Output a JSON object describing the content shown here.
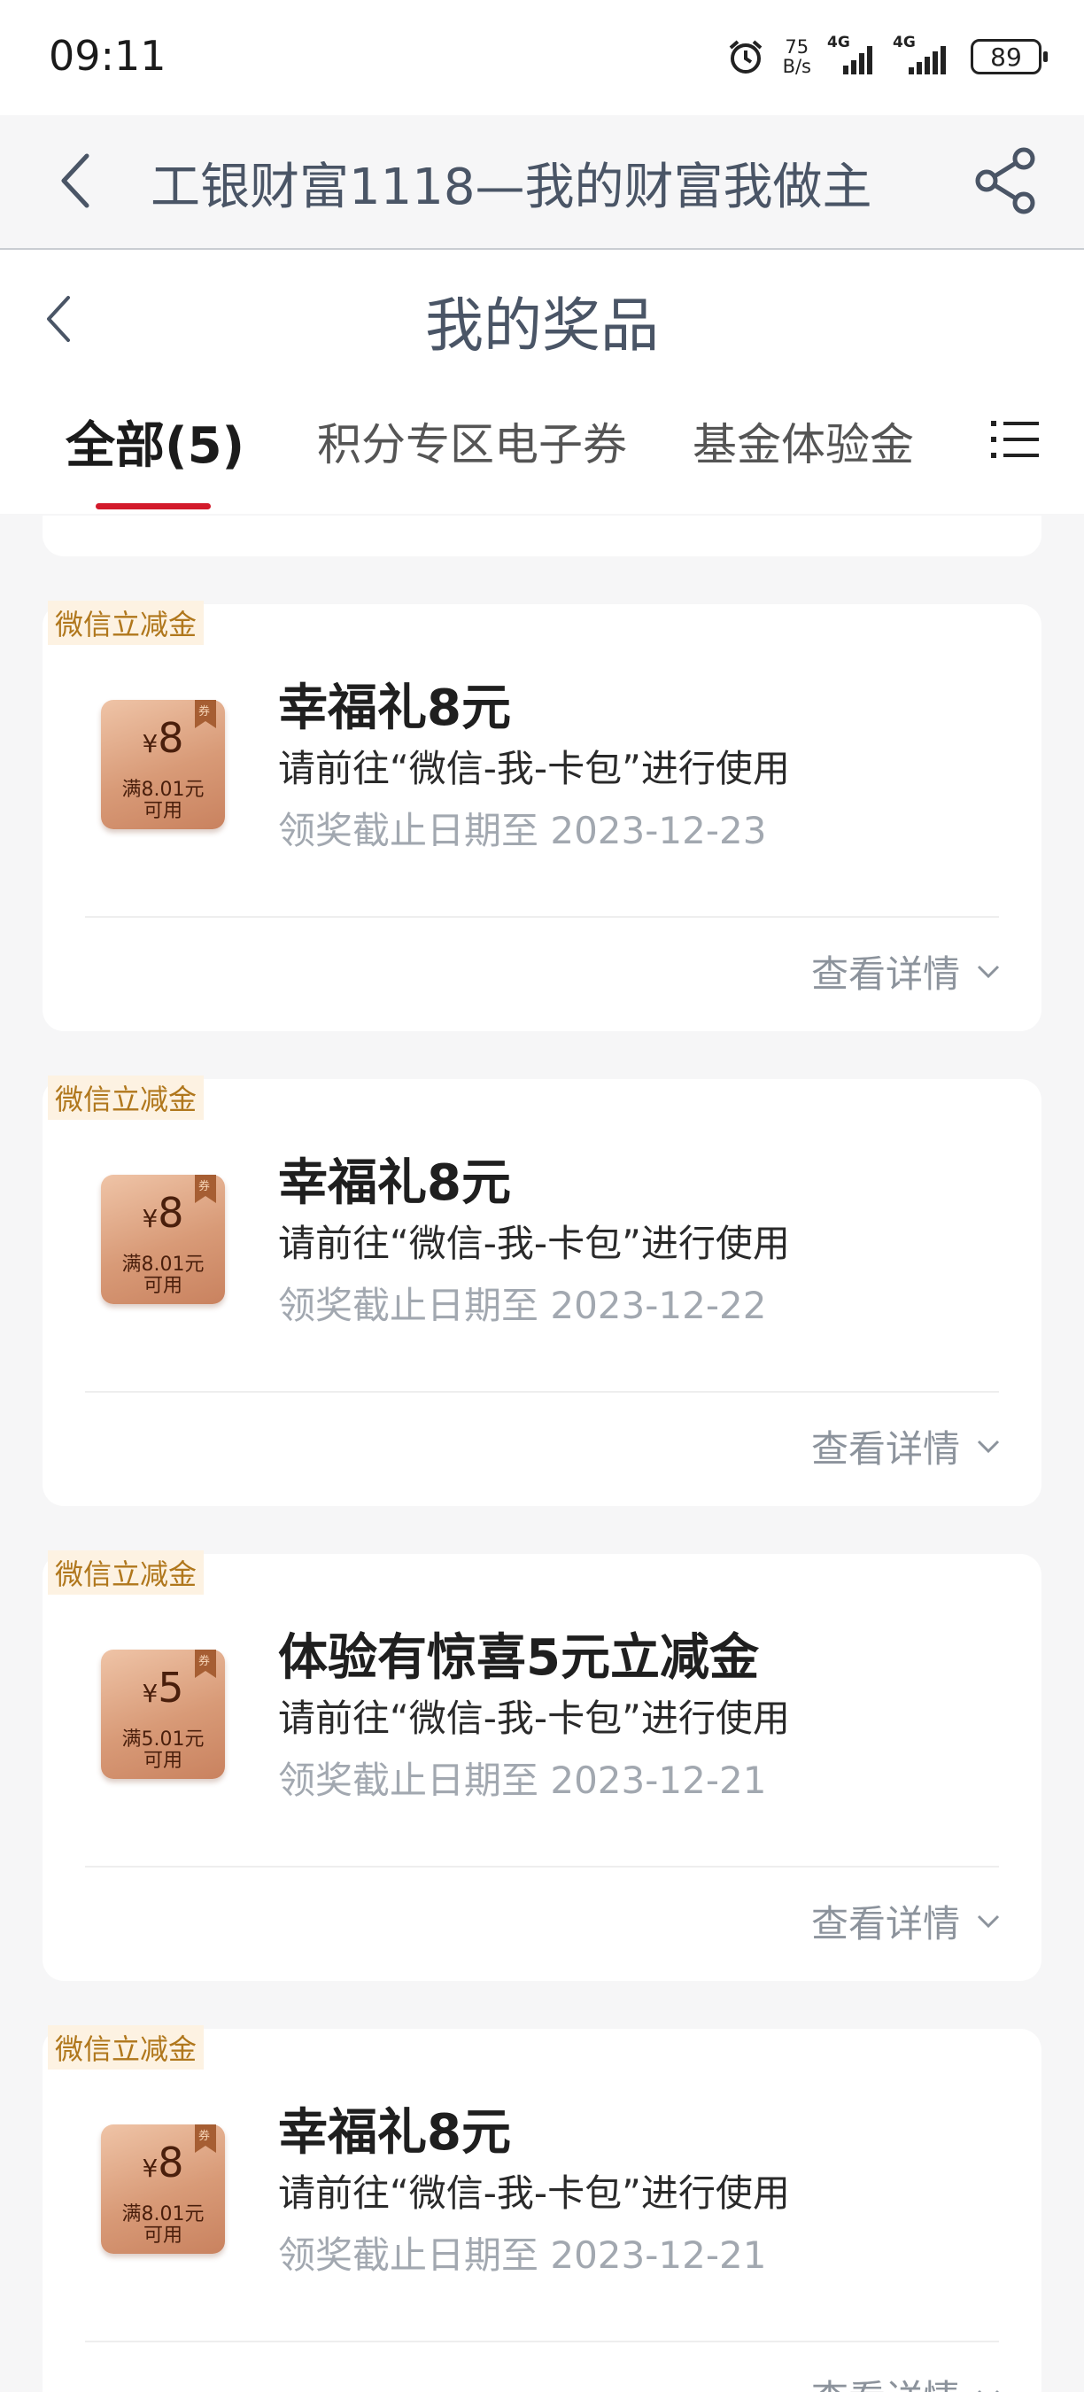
{
  "status_bar": {
    "time": "09:11",
    "net_speed_value": "75",
    "net_speed_unit": "B/s",
    "signal1": "4G",
    "signal2": "4G",
    "battery": "89"
  },
  "app_bar": {
    "title": "工银财富1118—我的财富我做主"
  },
  "page": {
    "title": "我的奖品"
  },
  "tabs": [
    {
      "label": "全部(5)",
      "active": true
    },
    {
      "label": "积分专区电子券",
      "active": false
    },
    {
      "label": "基金体验金",
      "active": false
    }
  ],
  "prizes": [
    {
      "tag": "微信立减金",
      "coupon_symbol": "¥",
      "coupon_amount": "8",
      "coupon_condition": "满8.01元",
      "coupon_usable": "可用",
      "coupon_flag": "券",
      "title": "幸福礼8元",
      "description": "请前往“微信-我-卡包”进行使用",
      "deadline": "领奖截止日期至 2023-12-23",
      "detail_label": "查看详情"
    },
    {
      "tag": "微信立减金",
      "coupon_symbol": "¥",
      "coupon_amount": "8",
      "coupon_condition": "满8.01元",
      "coupon_usable": "可用",
      "coupon_flag": "券",
      "title": "幸福礼8元",
      "description": "请前往“微信-我-卡包”进行使用",
      "deadline": "领奖截止日期至 2023-12-22",
      "detail_label": "查看详情"
    },
    {
      "tag": "微信立减金",
      "coupon_symbol": "¥",
      "coupon_amount": "5",
      "coupon_condition": "满5.01元",
      "coupon_usable": "可用",
      "coupon_flag": "券",
      "title": "体验有惊喜5元立减金",
      "description": "请前往“微信-我-卡包”进行使用",
      "deadline": "领奖截止日期至 2023-12-21",
      "detail_label": "查看详情"
    },
    {
      "tag": "微信立减金",
      "coupon_symbol": "¥",
      "coupon_amount": "8",
      "coupon_condition": "满8.01元",
      "coupon_usable": "可用",
      "coupon_flag": "券",
      "title": "幸福礼8元",
      "description": "请前往“微信-我-卡包”进行使用",
      "deadline": "领奖截止日期至 2023-12-21",
      "detail_label": "查看详情"
    }
  ],
  "icons": {
    "back": "chevron-left-icon",
    "share": "share-icon",
    "menu": "list-menu-icon",
    "expand": "chevron-down-icon"
  },
  "colors": {
    "tab_indicator": "#d31a2b",
    "tag_text": "#b0771c",
    "coupon_bg": "#d89a77"
  }
}
